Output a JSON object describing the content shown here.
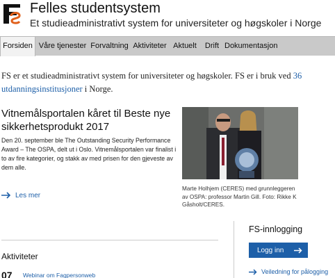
{
  "header": {
    "title": "Felles studentsystem",
    "subtitle": "Et studieadministrativt system for universiteter og høgskoler i Norge",
    "logo_icon": "fs-logo-icon"
  },
  "nav": {
    "items": [
      {
        "label": "Forsiden",
        "active": true
      },
      {
        "label": "Våre tjenester",
        "active": false
      },
      {
        "label": "Forvaltning",
        "active": false
      },
      {
        "label": "Aktiviteter",
        "active": false
      },
      {
        "label": "Aktuelt",
        "active": false
      },
      {
        "label": "Drift",
        "active": false
      },
      {
        "label": "Dokumentasjon",
        "active": false
      }
    ]
  },
  "intro": {
    "text_before": "FS er et studieadministrativt system for universiteter og høgskoler. FS er i bruk ved ",
    "link": "36 utdanningsinstitusjoner",
    "text_after": " i Norge."
  },
  "article": {
    "title": "Vitnemålsportalen kåret til Beste nye sikkerhetsprodukt 2017",
    "body": "Den 20. september ble The Outstanding Security Performance Award – The OSPA, delt ut i Oslo. Vitnemålsportalen var finalist i to av fire kategorier, og stakk av med prisen for den gjeveste av dem alle.",
    "read_more": "Les mer",
    "caption": "Marte Holhjem (CERES) med grunnleggeren av OSPA: professor Martin Gill. Foto: Rikke K Gåsholt/CERES."
  },
  "activities": {
    "title": "Aktiviteter",
    "events": [
      {
        "day": "07",
        "title": "Webinar om Fagpersonweb"
      }
    ]
  },
  "login": {
    "title": "FS-innlogging",
    "button": "Logg inn",
    "guide_link": "Veiledning for pålogging"
  },
  "colors": {
    "accent": "#1d5fa8",
    "nav_bg": "#c9c9c9",
    "nav_active_bg": "#f2f2f2"
  }
}
